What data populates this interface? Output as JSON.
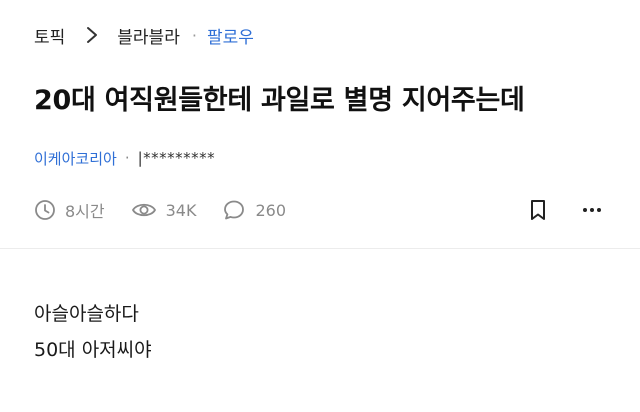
{
  "breadcrumb": {
    "root": "토픽",
    "board": "블라블라",
    "separator": "·",
    "follow": "팔로우"
  },
  "post": {
    "title": "20대 여직원들한테 과일로 별명 지어주는데",
    "author": {
      "company": "이케아코리아",
      "separator": "·",
      "name": "|*********"
    },
    "meta": {
      "time": "8시간",
      "views": "34K",
      "comments": "260",
      "icons": [
        "clock-icon",
        "eye-icon",
        "comment-icon",
        "bookmark-icon",
        "more-icon"
      ]
    },
    "body_lines": [
      "아슬아슬하다",
      "50대 아저씨야"
    ]
  },
  "colors": {
    "link": "#2f6fd6",
    "meta": "#8a8a8a",
    "title": "#111111"
  }
}
